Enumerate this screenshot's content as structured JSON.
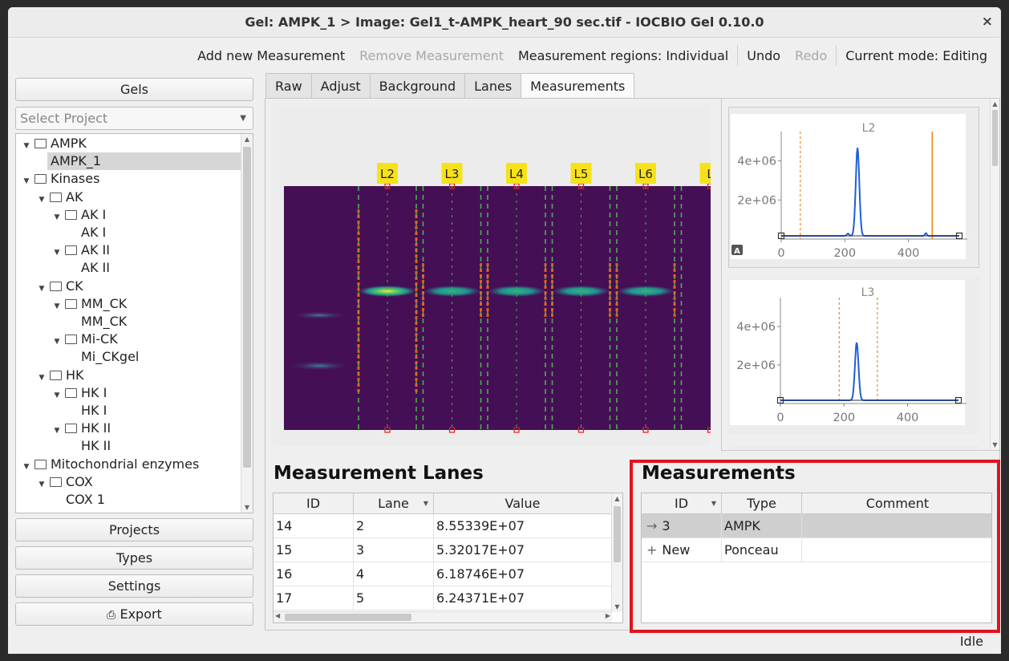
{
  "window": {
    "title": "Gel: AMPK_1 > Image: Gel1_t-AMPK_heart_90 sec.tif - IOCBIO Gel 0.10.0",
    "close_glyph": "×"
  },
  "toolbar": {
    "add_measurement": "Add new Measurement",
    "remove_measurement": "Remove Measurement",
    "regions": "Measurement regions: Individual",
    "undo": "Undo",
    "redo": "Redo",
    "mode": "Current mode: Editing"
  },
  "sidebar": {
    "gels_button": "Gels",
    "project_select_placeholder": "Select Project",
    "tree": [
      {
        "label": "AMPK",
        "level": 0,
        "type": "folder",
        "expanded": true
      },
      {
        "label": "AMPK_1",
        "level": 1,
        "type": "item",
        "selected": true
      },
      {
        "label": "Kinases",
        "level": 0,
        "type": "folder",
        "expanded": true
      },
      {
        "label": "AK",
        "level": 1,
        "type": "folder",
        "expanded": true
      },
      {
        "label": "AK I",
        "level": 2,
        "type": "folder",
        "expanded": true
      },
      {
        "label": "AK I",
        "level": 3,
        "type": "item"
      },
      {
        "label": "AK II",
        "level": 2,
        "type": "folder",
        "expanded": true
      },
      {
        "label": "AK II",
        "level": 3,
        "type": "item"
      },
      {
        "label": "CK",
        "level": 1,
        "type": "folder",
        "expanded": true
      },
      {
        "label": "MM_CK",
        "level": 2,
        "type": "folder",
        "expanded": true
      },
      {
        "label": "MM_CK",
        "level": 3,
        "type": "item"
      },
      {
        "label": "Mi-CK",
        "level": 2,
        "type": "folder",
        "expanded": true
      },
      {
        "label": "Mi_CKgel",
        "level": 3,
        "type": "item"
      },
      {
        "label": "HK",
        "level": 1,
        "type": "folder",
        "expanded": true
      },
      {
        "label": "HK I",
        "level": 2,
        "type": "folder",
        "expanded": true
      },
      {
        "label": "HK I",
        "level": 3,
        "type": "item"
      },
      {
        "label": "HK II",
        "level": 2,
        "type": "folder",
        "expanded": true
      },
      {
        "label": "HK II",
        "level": 3,
        "type": "item"
      },
      {
        "label": "Mitochondrial enzymes",
        "level": 0,
        "type": "folder",
        "expanded": true
      },
      {
        "label": "COX",
        "level": 1,
        "type": "folder",
        "expanded": true
      },
      {
        "label": "COX 1",
        "level": 2,
        "type": "item"
      }
    ],
    "projects_button": "Projects",
    "types_button": "Types",
    "settings_button": "Settings",
    "export_button": "Export"
  },
  "tabs": [
    "Raw",
    "Adjust",
    "Background",
    "Lanes",
    "Measurements"
  ],
  "active_tab": "Measurements",
  "gel": {
    "lane_labels": [
      "L2",
      "L3",
      "L4",
      "L5",
      "L6",
      "L"
    ]
  },
  "plots": [
    {
      "chart_data": {
        "type": "line",
        "title": "L2",
        "xlim": [
          0,
          560
        ],
        "ylim": [
          0,
          5500000
        ],
        "x_ticks": [
          "0",
          "200",
          "400"
        ],
        "y_ticks": [
          "2e+06",
          "4e+06"
        ],
        "peak_x": 240,
        "peak_y": 4500000,
        "region_left": 60,
        "region_right": 475,
        "auto_label": "A"
      }
    },
    {
      "chart_data": {
        "type": "line",
        "title": "L3",
        "xlim": [
          0,
          560
        ],
        "ylim": [
          0,
          5500000
        ],
        "x_ticks": [
          "0",
          "200",
          "400"
        ],
        "y_ticks": [
          "2e+06",
          "4e+06"
        ],
        "peak_x": 240,
        "peak_y": 3000000,
        "region_left": 185,
        "region_right": 305
      }
    }
  ],
  "measurement_lanes": {
    "title": "Measurement Lanes",
    "columns": [
      "ID",
      "Lane",
      "Value"
    ],
    "rows": [
      [
        "14",
        "2",
        "8.55339E+07"
      ],
      [
        "15",
        "3",
        "5.32017E+07"
      ],
      [
        "16",
        "4",
        "6.18746E+07"
      ],
      [
        "17",
        "5",
        "6.24371E+07"
      ]
    ]
  },
  "measurements": {
    "title": "Measurements",
    "columns": [
      "ID",
      "Type",
      "Comment"
    ],
    "rows": [
      {
        "marker": "→",
        "id": "3",
        "type": "AMPK",
        "comment": ""
      },
      {
        "marker": "+",
        "id": "New",
        "type": "Ponceau",
        "comment": ""
      }
    ]
  },
  "status": "Idle",
  "colors": {
    "highlight": "#e0141e",
    "gel_background": "#440f55",
    "lane_label_bg": "#f7e21a",
    "peak_line": "#1f5fd6",
    "region_line": "#e98a1a"
  }
}
